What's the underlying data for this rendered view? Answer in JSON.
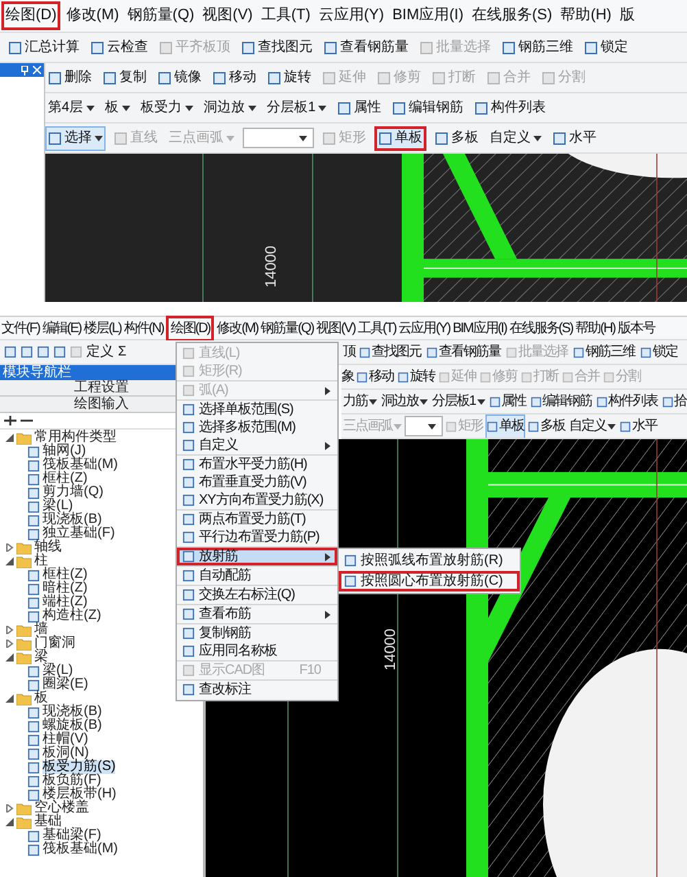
{
  "top_window": {
    "menu_bar": [
      {
        "label": "绘图(D)",
        "boxed": true
      },
      {
        "label": "修改(M)",
        "boxed": false
      },
      {
        "label": "钢筋量(Q)",
        "boxed": false
      },
      {
        "label": "视图(V)",
        "boxed": false
      },
      {
        "label": "工具(T)",
        "boxed": false
      },
      {
        "label": "云应用(Y)",
        "boxed": false
      },
      {
        "label": "BIM应用(I)",
        "boxed": false
      },
      {
        "label": "在线服务(S)",
        "boxed": false
      },
      {
        "label": "帮助(H)",
        "boxed": false
      },
      {
        "label": "版",
        "boxed": false
      }
    ],
    "toolbar_1": [
      {
        "kind": "button",
        "label": "汇总计算",
        "disabled": false
      },
      {
        "kind": "button",
        "label": "云检查",
        "disabled": false
      },
      {
        "kind": "button",
        "label": "平齐板顶",
        "disabled": true
      },
      {
        "kind": "button",
        "label": "查找图元",
        "disabled": false
      },
      {
        "kind": "button",
        "label": "查看钢筋量",
        "disabled": false
      },
      {
        "kind": "button",
        "label": "批量选择",
        "disabled": true
      },
      {
        "kind": "button",
        "label": "钢筋三维",
        "disabled": false
      },
      {
        "kind": "button",
        "label": "锁定",
        "disabled": false
      }
    ],
    "toolbar_2": [
      {
        "kind": "button",
        "label": "删除",
        "disabled": false
      },
      {
        "kind": "button",
        "label": "复制",
        "disabled": false
      },
      {
        "kind": "button",
        "label": "镜像",
        "disabled": false
      },
      {
        "kind": "button",
        "label": "移动",
        "disabled": false
      },
      {
        "kind": "button",
        "label": "旋转",
        "disabled": false
      },
      {
        "kind": "button",
        "label": "延伸",
        "disabled": true
      },
      {
        "kind": "button",
        "label": "修剪",
        "disabled": true
      },
      {
        "kind": "button",
        "label": "打断",
        "disabled": true
      },
      {
        "kind": "button",
        "label": "合并",
        "disabled": true
      },
      {
        "kind": "button",
        "label": "分割",
        "disabled": true
      }
    ],
    "toolbar_3": [
      {
        "kind": "dropdown",
        "label": "第4层"
      },
      {
        "kind": "dropdown",
        "label": "板"
      },
      {
        "kind": "dropdown",
        "label": "板受力"
      },
      {
        "kind": "dropdown",
        "label": "洞边放"
      },
      {
        "kind": "dropdown",
        "label": "分层板1"
      },
      {
        "kind": "button",
        "label": "属性",
        "disabled": false
      },
      {
        "kind": "button",
        "label": "编辑钢筋",
        "disabled": false
      },
      {
        "kind": "button",
        "label": "构件列表",
        "disabled": false
      }
    ],
    "toolbar_4": [
      {
        "kind": "split",
        "label": "选择",
        "selected": true,
        "disabled": false,
        "boxed": false
      },
      {
        "kind": "button",
        "label": "直线",
        "selected": false,
        "disabled": true,
        "boxed": false
      },
      {
        "kind": "dropdown",
        "label": "三点画弧",
        "selected": false,
        "disabled": true,
        "boxed": false
      },
      {
        "kind": "combo",
        "selected": false
      },
      {
        "kind": "button",
        "label": "矩形",
        "selected": false,
        "disabled": true,
        "boxed": false
      },
      {
        "kind": "button",
        "label": "单板",
        "selected": true,
        "disabled": false,
        "boxed": true
      },
      {
        "kind": "button",
        "label": "多板",
        "selected": false,
        "disabled": false,
        "boxed": false
      },
      {
        "kind": "dropdown",
        "label": "自定义",
        "selected": false,
        "disabled": false,
        "boxed": false
      },
      {
        "kind": "button",
        "label": "水平",
        "selected": false,
        "disabled": false,
        "boxed": false
      }
    ],
    "canvas": {
      "dimension": "14000"
    }
  },
  "bottom_window": {
    "menu_bar": [
      {
        "label": "文件(F)",
        "boxed": false
      },
      {
        "label": "编辑(E)",
        "boxed": false
      },
      {
        "label": "楼层(L)",
        "boxed": false
      },
      {
        "label": "构件(N)",
        "boxed": false
      },
      {
        "label": "绘图(D)",
        "boxed": true
      },
      {
        "label": "修改(M)",
        "boxed": false
      },
      {
        "label": "钢筋量(Q)",
        "boxed": false
      },
      {
        "label": "视图(V)",
        "boxed": false
      },
      {
        "label": "工具(T)",
        "boxed": false
      },
      {
        "label": "云应用(Y)",
        "boxed": false
      },
      {
        "label": "BIM应用(I)",
        "boxed": false
      },
      {
        "label": "在线服务(S)",
        "boxed": false
      },
      {
        "label": "帮助(H)",
        "boxed": false
      },
      {
        "label": "版本号",
        "boxed": false
      }
    ],
    "toolbar_left": [
      {
        "label": "定义"
      },
      {
        "label": "Σ"
      }
    ],
    "toolbar_right": [
      {
        "kind": "text",
        "label": "顶"
      },
      {
        "kind": "button",
        "label": "查找图元",
        "disabled": false
      },
      {
        "kind": "button",
        "label": "查看钢筋量",
        "disabled": false
      },
      {
        "kind": "button",
        "label": "批量选择",
        "disabled": true
      },
      {
        "kind": "button",
        "label": "钢筋三维",
        "disabled": false
      },
      {
        "kind": "button",
        "label": "锁定",
        "disabled": false
      }
    ],
    "toolbar_edit": [
      {
        "kind": "text",
        "label": "象"
      },
      {
        "kind": "button",
        "label": "移动",
        "disabled": false
      },
      {
        "kind": "button",
        "label": "旋转",
        "disabled": false
      },
      {
        "kind": "button",
        "label": "延伸",
        "disabled": true
      },
      {
        "kind": "button",
        "label": "修剪",
        "disabled": true
      },
      {
        "kind": "button",
        "label": "打断",
        "disabled": true
      },
      {
        "kind": "button",
        "label": "合并",
        "disabled": true
      },
      {
        "kind": "button",
        "label": "分割",
        "disabled": true
      }
    ],
    "toolbar_layer": [
      {
        "kind": "dropdown",
        "label": "力筋"
      },
      {
        "kind": "dropdown",
        "label": "洞边放"
      },
      {
        "kind": "dropdown",
        "label": "分层板1"
      },
      {
        "kind": "button",
        "label": "属性",
        "disabled": false
      },
      {
        "kind": "button",
        "label": "编辑钢筋",
        "disabled": false
      },
      {
        "kind": "button",
        "label": "构件列表",
        "disabled": false
      },
      {
        "kind": "button",
        "label": "拾",
        "disabled": false
      }
    ],
    "toolbar_draw": [
      {
        "kind": "dropdown",
        "label": "三点画弧",
        "selected": false,
        "disabled": true,
        "boxed": false
      },
      {
        "kind": "combo",
        "selected": false
      },
      {
        "kind": "button",
        "label": "矩形",
        "selected": false,
        "disabled": true,
        "boxed": false
      },
      {
        "kind": "button",
        "label": "单板",
        "selected": true,
        "disabled": false,
        "boxed": false
      },
      {
        "kind": "button",
        "label": "多板",
        "selected": false,
        "disabled": false,
        "boxed": false
      },
      {
        "kind": "dropdown",
        "label": "自定义",
        "selected": false,
        "disabled": false,
        "boxed": false
      },
      {
        "kind": "button",
        "label": "水平",
        "selected": false,
        "disabled": false,
        "boxed": false
      }
    ],
    "nav_panel": {
      "title": "模块导航栏",
      "buttons": [
        "工程设置",
        "绘图输入"
      ],
      "tree": [
        {
          "label": "常用构件类型",
          "expanded": true,
          "children": [
            {
              "label": "轴网(J)",
              "selected": false
            },
            {
              "label": "筏板基础(M)",
              "selected": false
            },
            {
              "label": "框柱(Z)",
              "selected": false
            },
            {
              "label": "剪力墙(Q)",
              "selected": false
            },
            {
              "label": "梁(L)",
              "selected": false
            },
            {
              "label": "现浇板(B)",
              "selected": false
            },
            {
              "label": "独立基础(F)",
              "selected": false
            }
          ]
        },
        {
          "label": "轴线",
          "expanded": false
        },
        {
          "label": "柱",
          "expanded": true,
          "children": [
            {
              "label": "框柱(Z)",
              "selected": false
            },
            {
              "label": "暗柱(Z)",
              "selected": false
            },
            {
              "label": "端柱(Z)",
              "selected": false
            },
            {
              "label": "构造柱(Z)",
              "selected": false
            }
          ]
        },
        {
          "label": "墙",
          "expanded": false
        },
        {
          "label": "门窗洞",
          "expanded": false
        },
        {
          "label": "梁",
          "expanded": true,
          "children": [
            {
              "label": "梁(L)",
              "selected": false
            },
            {
              "label": "圈梁(E)",
              "selected": false
            }
          ]
        },
        {
          "label": "板",
          "expanded": true,
          "children": [
            {
              "label": "现浇板(B)",
              "selected": false
            },
            {
              "label": "螺旋板(B)",
              "selected": false
            },
            {
              "label": "柱帽(V)",
              "selected": false
            },
            {
              "label": "板洞(N)",
              "selected": false
            },
            {
              "label": "板受力筋(S)",
              "selected": true
            },
            {
              "label": "板负筋(F)",
              "selected": false
            },
            {
              "label": "楼层板带(H)",
              "selected": false
            }
          ]
        },
        {
          "label": "空心楼盖",
          "expanded": false
        },
        {
          "label": "基础",
          "expanded": true,
          "children": [
            {
              "label": "基础梁(F)",
              "selected": false
            },
            {
              "label": "筏板基础(M)",
              "selected": false
            }
          ]
        }
      ]
    },
    "draw_menu": {
      "groups": [
        [
          {
            "label": "直线(L)",
            "disabled": true,
            "submenu": false,
            "selected": false,
            "boxed": false
          },
          {
            "label": "矩形(R)",
            "disabled": true,
            "submenu": false,
            "selected": false,
            "boxed": false
          }
        ],
        [
          {
            "label": "弧(A)",
            "disabled": true,
            "submenu": true,
            "selected": false,
            "boxed": false
          }
        ],
        [
          {
            "label": "选择单板范围(S)",
            "disabled": false,
            "submenu": false,
            "selected": false,
            "boxed": false
          },
          {
            "label": "选择多板范围(M)",
            "disabled": false,
            "submenu": false,
            "selected": false,
            "boxed": false
          },
          {
            "label": "自定义",
            "disabled": false,
            "submenu": true,
            "selected": false,
            "boxed": false
          }
        ],
        [
          {
            "label": "布置水平受力筋(H)",
            "disabled": false,
            "submenu": false,
            "selected": false,
            "boxed": false
          },
          {
            "label": "布置垂直受力筋(V)",
            "disabled": false,
            "submenu": false,
            "selected": false,
            "boxed": false
          },
          {
            "label": "XY方向布置受力筋(X)",
            "disabled": false,
            "submenu": false,
            "selected": false,
            "boxed": false
          }
        ],
        [
          {
            "label": "两点布置受力筋(T)",
            "disabled": false,
            "submenu": false,
            "selected": false,
            "boxed": false
          },
          {
            "label": "平行边布置受力筋(P)",
            "disabled": false,
            "submenu": false,
            "selected": false,
            "boxed": false
          }
        ],
        [
          {
            "label": "放射筋",
            "disabled": false,
            "submenu": true,
            "selected": true,
            "boxed": true
          }
        ],
        [
          {
            "label": "自动配筋",
            "disabled": false,
            "submenu": false,
            "selected": false,
            "boxed": false
          }
        ],
        [
          {
            "label": "交换左右标注(Q)",
            "disabled": false,
            "submenu": false,
            "selected": false,
            "boxed": false
          }
        ],
        [
          {
            "label": "查看布筋",
            "disabled": false,
            "submenu": true,
            "selected": false,
            "boxed": false
          }
        ],
        [
          {
            "label": "复制钢筋",
            "disabled": false,
            "submenu": false,
            "selected": false,
            "boxed": false
          },
          {
            "label": "应用同名称板",
            "disabled": false,
            "submenu": false,
            "selected": false,
            "boxed": false
          }
        ],
        [
          {
            "label": "显示CAD图",
            "shortcut": "F10",
            "disabled": true,
            "submenu": false,
            "selected": false,
            "boxed": false
          }
        ],
        [
          {
            "label": "查改标注",
            "disabled": false,
            "submenu": false,
            "selected": false,
            "boxed": false
          }
        ]
      ],
      "submenu": [
        {
          "label": "按照弧线布置放射筋(R)",
          "boxed": false
        },
        {
          "label": "按照圆心布置放射筋(C)",
          "boxed": true
        }
      ]
    },
    "canvas": {
      "dimension": "14000"
    }
  }
}
